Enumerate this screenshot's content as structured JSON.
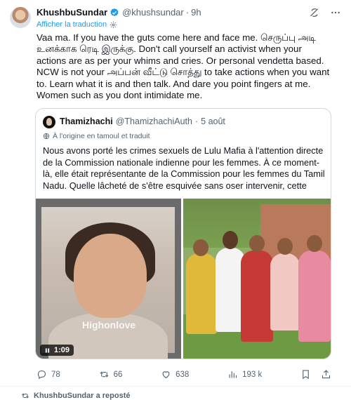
{
  "tweet": {
    "author_name": "KhushbuSundar",
    "author_handle": "@khushsundar",
    "separator": "·",
    "time": "9h",
    "translate_label": "Afficher la traduction",
    "text": "Vaa ma. If you have the guts come here and face me. செருப்பு அடி உனக்காக ரெடி இருக்கு.  Don't call yourself an activist when your actions are as per your whims and cries. Or personal vendetta based. NCW is not your அப்பன் வீட்டு சொத்து to take actions when you want to. Learn what it is and then talk. And dare you point fingers at me. Women such as you dont intimidate me."
  },
  "quote": {
    "author_name": "Thamizhachi",
    "author_handle": "@ThamizhachiAuth",
    "separator": "·",
    "time": "5 août",
    "translation_note": "À l'origine en tamoul et traduit",
    "text": "Nous avons porté les crimes sexuels de Lulu Mafia à l'attention directe de la Commission nationale indienne pour les femmes. À ce moment-là, elle était représentante de la Commission pour les femmes du Tamil Nadu. Quelle lâcheté de s'être esquivée sans oser intervenir, cette",
    "video_watermark": "Highonlove",
    "video_duration": "1:09"
  },
  "actions": {
    "replies": "78",
    "reposts": "66",
    "likes": "638",
    "views": "193 k"
  },
  "footer": {
    "reposted_label": "KhushbuSundar a reposté"
  },
  "colors": {
    "accent": "#1d9bf0",
    "secondary_text": "#536471",
    "border": "#cfd9de"
  },
  "icons": [
    "verified-badge-icon",
    "grok-icon",
    "more-icon",
    "gear-icon",
    "reply-icon",
    "repost-icon",
    "like-icon",
    "views-icon",
    "bookmark-icon",
    "share-icon",
    "play-icon"
  ]
}
